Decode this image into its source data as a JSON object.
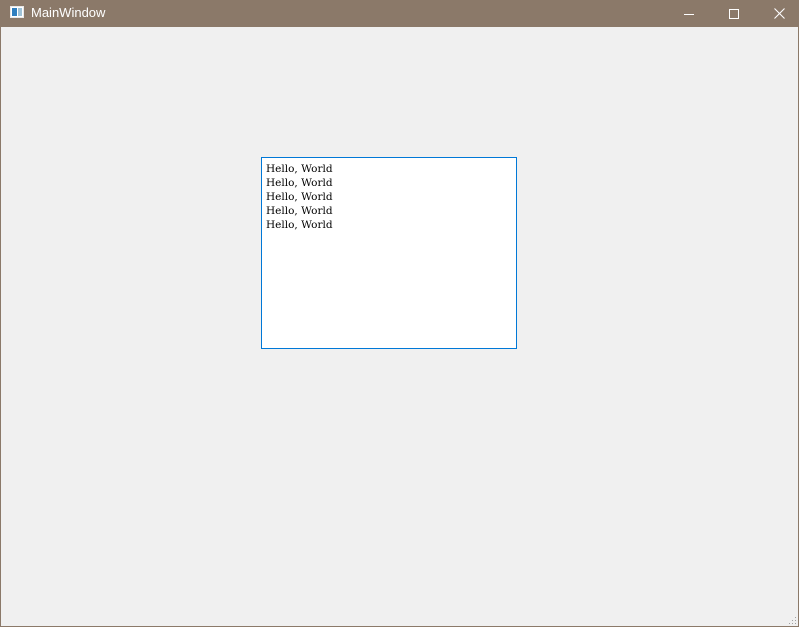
{
  "window": {
    "title": "MainWindow",
    "titlebar_color": "#8b7969",
    "controls": {
      "minimize_icon": "minimize-icon",
      "maximize_icon": "maximize-icon",
      "close_icon": "close-icon"
    }
  },
  "editor": {
    "border_color": "#0078d7",
    "lines": [
      "Hello, World",
      "Hello, World",
      "Hello, World",
      "Hello, World",
      "Hello, World"
    ]
  }
}
